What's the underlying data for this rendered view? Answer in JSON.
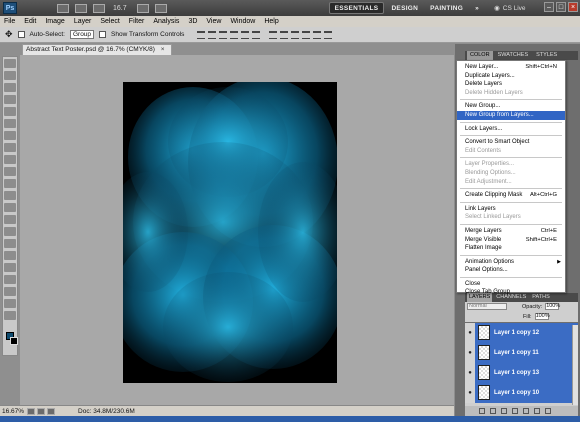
{
  "app": {
    "zoom_label": "16.7",
    "workspaces": [
      "ESSENTIALS",
      "DESIGN",
      "PAINTING"
    ],
    "more": "»",
    "cs_live": "CS Live"
  },
  "menubar": [
    "File",
    "Edit",
    "Image",
    "Layer",
    "Select",
    "Filter",
    "Analysis",
    "3D",
    "View",
    "Window",
    "Help"
  ],
  "options": {
    "auto_select_label": "Auto-Select:",
    "auto_select_value": "Group",
    "show_transform_label": "Show Transform Controls"
  },
  "document": {
    "tab_title": "Abstract Text Poster.psd @ 16.7% (CMYK/8)",
    "close": "×",
    "zoom": "16.67%",
    "doc_info": "Doc: 34.8M/230.6M"
  },
  "panel_tabs": [
    "COLOR",
    "SWATCHES",
    "STYLES"
  ],
  "flyout": {
    "items": [
      {
        "label": "New Layer...",
        "shortcut": "Shift+Ctrl+N",
        "disabled": false
      },
      {
        "label": "Duplicate Layers...",
        "shortcut": "",
        "disabled": false
      },
      {
        "label": "Delete Layers",
        "shortcut": "",
        "disabled": false
      },
      {
        "label": "Delete Hidden Layers",
        "shortcut": "",
        "disabled": true
      },
      {
        "sep": true
      },
      {
        "label": "New Group...",
        "shortcut": "",
        "disabled": false
      },
      {
        "label": "New Group from Layers...",
        "shortcut": "",
        "disabled": false,
        "highlighted": true
      },
      {
        "sep": true
      },
      {
        "label": "Lock Layers...",
        "shortcut": "",
        "disabled": false
      },
      {
        "sep": true
      },
      {
        "label": "Convert to Smart Object",
        "shortcut": "",
        "disabled": false
      },
      {
        "label": "Edit Contents",
        "shortcut": "",
        "disabled": true
      },
      {
        "sep": true
      },
      {
        "label": "Layer Properties...",
        "shortcut": "",
        "disabled": true
      },
      {
        "label": "Blending Options...",
        "shortcut": "",
        "disabled": true
      },
      {
        "label": "Edit Adjustment...",
        "shortcut": "",
        "disabled": true
      },
      {
        "sep": true
      },
      {
        "label": "Create Clipping Mask",
        "shortcut": "Alt+Ctrl+G",
        "disabled": false
      },
      {
        "sep": true
      },
      {
        "label": "Link Layers",
        "shortcut": "",
        "disabled": false
      },
      {
        "label": "Select Linked Layers",
        "shortcut": "",
        "disabled": true
      },
      {
        "sep": true
      },
      {
        "label": "Merge Layers",
        "shortcut": "Ctrl+E",
        "disabled": false
      },
      {
        "label": "Merge Visible",
        "shortcut": "Shift+Ctrl+E",
        "disabled": false
      },
      {
        "label": "Flatten Image",
        "shortcut": "",
        "disabled": false
      },
      {
        "sep": true
      },
      {
        "label": "Animation Options",
        "shortcut": "",
        "disabled": false,
        "submenu": true
      },
      {
        "label": "Panel Options...",
        "shortcut": "",
        "disabled": false
      },
      {
        "sep": true
      },
      {
        "label": "Close",
        "shortcut": "",
        "disabled": false
      },
      {
        "label": "Close Tab Group",
        "shortcut": "",
        "disabled": false
      }
    ]
  },
  "layers_panel": {
    "tabs": [
      "LAYERS",
      "CHANNELS",
      "PATHS"
    ],
    "blend_mode": "Normal",
    "opacity_label": "Opacity:",
    "opacity_value": "100%",
    "fill_label": "Fill:",
    "fill_value": "100%",
    "layers": [
      "Layer 1 copy 12",
      "Layer 1 copy 11",
      "Layer 1 copy 13",
      "Layer 1 copy 10"
    ],
    "eye_icon": "●"
  },
  "colors": {
    "accent": "#3165c4",
    "artwork_cyan": "#1aa6d8"
  }
}
